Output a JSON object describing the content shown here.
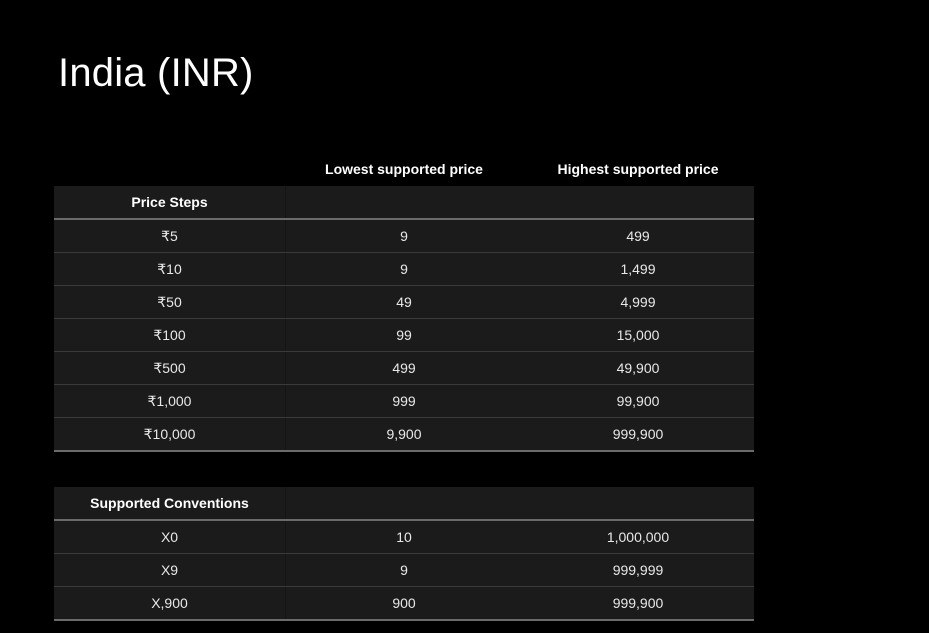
{
  "page": {
    "title": "India (INR)"
  },
  "columns": {
    "lowest": "Lowest supported price",
    "highest": "Highest supported price"
  },
  "price_steps": {
    "header": "Price Steps",
    "rows": [
      {
        "step": "₹5",
        "lowest": "9",
        "highest": "499"
      },
      {
        "step": "₹10",
        "lowest": "9",
        "highest": "1,499"
      },
      {
        "step": "₹50",
        "lowest": "49",
        "highest": "4,999"
      },
      {
        "step": "₹100",
        "lowest": "99",
        "highest": "15,000"
      },
      {
        "step": "₹500",
        "lowest": "499",
        "highest": "49,900"
      },
      {
        "step": "₹1,000",
        "lowest": "999",
        "highest": "99,900"
      },
      {
        "step": "₹10,000",
        "lowest": "9,900",
        "highest": "999,900"
      }
    ]
  },
  "supported_conventions": {
    "header": "Supported Conventions",
    "rows": [
      {
        "convention": "X0",
        "lowest": "10",
        "highest": "1,000,000"
      },
      {
        "convention": "X9",
        "lowest": "9",
        "highest": "999,999"
      },
      {
        "convention": "X,900",
        "lowest": "900",
        "highest": "999,900"
      }
    ]
  },
  "colors": {
    "background": "#000000",
    "table_background": "#1b1b1b",
    "row_divider": "#3a3a3a",
    "header_divider": "#6b6b6b",
    "text": "#ffffff"
  }
}
